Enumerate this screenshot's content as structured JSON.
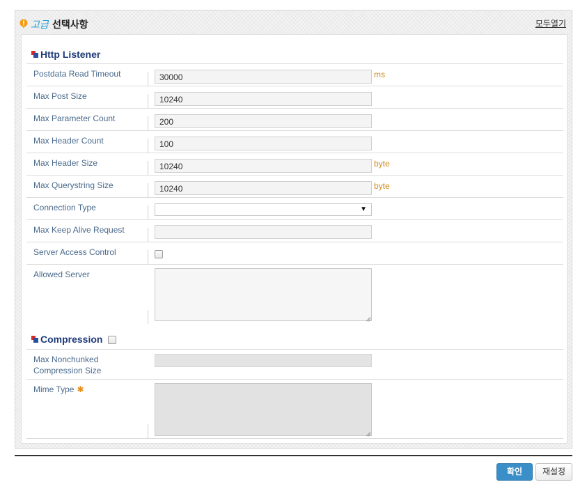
{
  "header": {
    "prefix": "고급",
    "title": "선택사항",
    "expand_all_link": "모두열기"
  },
  "http_listener": {
    "title": "Http Listener",
    "fields": {
      "postdata_read_timeout": {
        "label": "Postdata Read Timeout",
        "value": "30000",
        "unit": "ms"
      },
      "max_post_size": {
        "label": "Max Post Size",
        "value": "10240"
      },
      "max_parameter_count": {
        "label": "Max Parameter Count",
        "value": "200"
      },
      "max_header_count": {
        "label": "Max Header Count",
        "value": "100"
      },
      "max_header_size": {
        "label": "Max Header Size",
        "value": "10240",
        "unit": "byte"
      },
      "max_querystring_size": {
        "label": "Max Querystring Size",
        "value": "10240",
        "unit": "byte"
      },
      "connection_type": {
        "label": "Connection Type",
        "value": ""
      },
      "max_keep_alive_request": {
        "label": "Max Keep Alive Request",
        "value": ""
      },
      "server_access_control": {
        "label": "Server Access Control",
        "checked": false
      },
      "allowed_server": {
        "label": "Allowed Server",
        "value": ""
      }
    }
  },
  "compression": {
    "title": "Compression",
    "enabled": false,
    "fields": {
      "max_nonchunked_size": {
        "label_line1": "Max Nonchunked",
        "label_line2": "Compression Size",
        "value": ""
      },
      "mime_type": {
        "label": "Mime Type",
        "required_mark": "✱",
        "value": ""
      }
    }
  },
  "buttons": {
    "confirm": "확인",
    "reset": "재설정"
  },
  "colors": {
    "label": "#4a6a8c",
    "section_title": "#1e3a78",
    "unit": "#d08a1a",
    "accent_button": "#3a8fc8",
    "header_prefix": "#1e9ed6"
  }
}
